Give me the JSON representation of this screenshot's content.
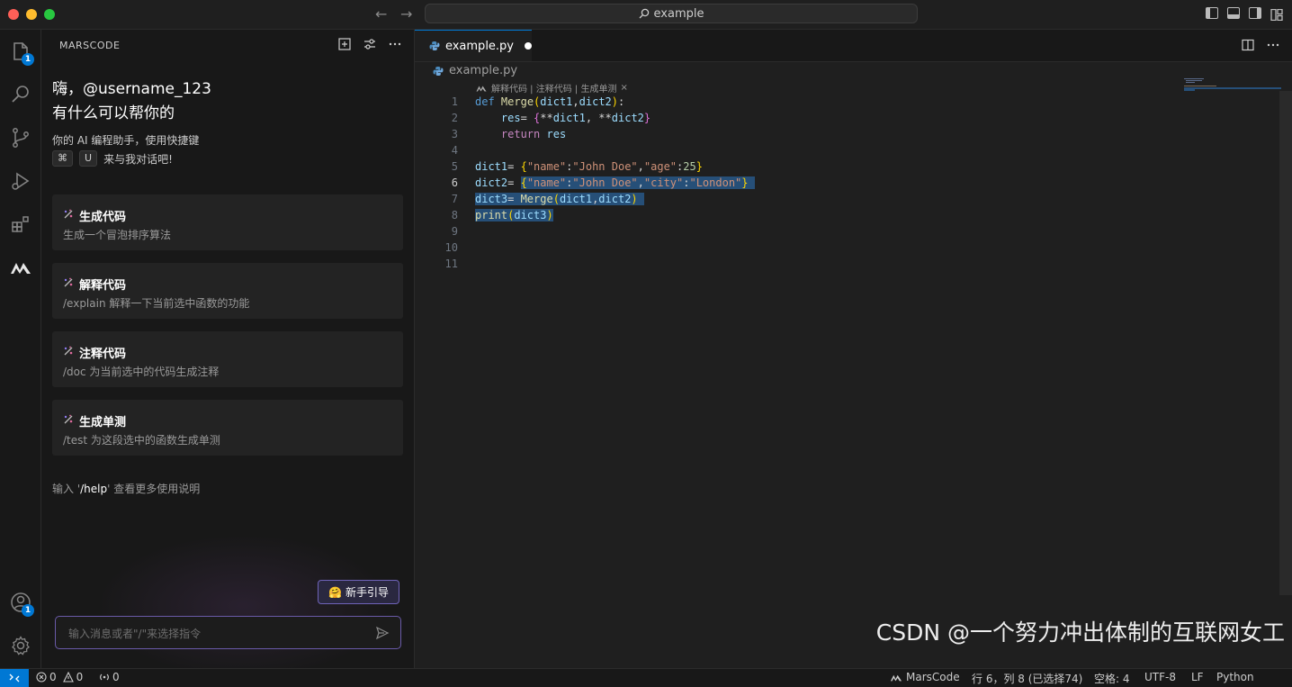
{
  "window": {
    "search_text": "example"
  },
  "activity": {
    "explorer_badge": "1",
    "accounts_badge": "1"
  },
  "sidebar": {
    "title": "MARSCODE",
    "greeting_line1": "嗨，@username_123",
    "greeting_line2": "有什么可以帮你的",
    "description_line1": "你的 AI 编程助手，使用快捷键",
    "shortcut_key1": "⌘",
    "shortcut_key2": "U",
    "description_line2_suffix": "来与我对话吧!",
    "cards": [
      {
        "title": "生成代码",
        "desc": "生成一个冒泡排序算法"
      },
      {
        "title": "解释代码",
        "desc": "/explain 解释一下当前选中函数的功能"
      },
      {
        "title": "注释代码",
        "desc": "/doc 为当前选中的代码生成注释"
      },
      {
        "title": "生成单测",
        "desc": "/test 为这段选中的函数生成单测"
      }
    ],
    "help_prefix": "输入 '",
    "help_command": "/help",
    "help_suffix": "' 查看更多使用说明",
    "guide_button": "新手引导",
    "guide_emoji": "🤗",
    "chat_placeholder": "输入消息或者\"/\"来选择指令"
  },
  "editor": {
    "tab_label": "example.py",
    "breadcrumb_file": "example.py",
    "codelens": "解释代码 | 注释代码 | 生成单测",
    "codelens_close": "×",
    "line_numbers": [
      "1",
      "2",
      "3",
      "4",
      "5",
      "6",
      "7",
      "8",
      "9",
      "10",
      "11"
    ],
    "active_line": "6"
  },
  "watermark": "CSDN @一个努力冲出体制的互联网女工",
  "status": {
    "errors": "0",
    "warnings": "0",
    "ports": "0",
    "marscode": "MarsCode",
    "cursor": "行 6，列 8 (已选择74)",
    "indent": "空格: 4",
    "encoding": "UTF-8",
    "eol": "LF",
    "language": "Python"
  }
}
